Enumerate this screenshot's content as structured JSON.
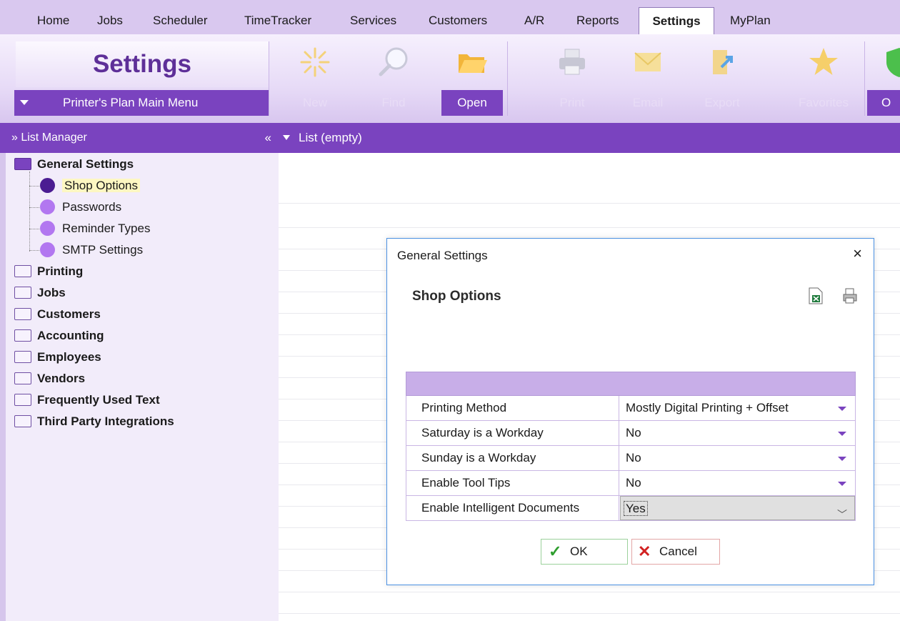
{
  "menu": {
    "tabs": [
      "Home",
      "Jobs",
      "Scheduler",
      "TimeTracker",
      "Services",
      "Customers",
      "A/R",
      "Reports",
      "Settings",
      "MyPlan"
    ],
    "active": "Settings"
  },
  "ribbon": {
    "title": "Settings",
    "main_menu": "Printer's Plan Main Menu",
    "buttons": {
      "new": "New",
      "find": "Find",
      "open": "Open",
      "print": "Print",
      "email": "Email",
      "export": "Export",
      "favorites": "Favorites",
      "ok": "O"
    }
  },
  "list_manager": {
    "title": "List Manager",
    "collapse_glyph": "«",
    "header_glyph": "»"
  },
  "list_header": {
    "title": "List (empty)"
  },
  "tree": {
    "general_settings": "General Settings",
    "children": [
      "Shop Options",
      "Passwords",
      "Reminder Types",
      "SMTP Settings"
    ],
    "folders": [
      "Printing",
      "Jobs",
      "Customers",
      "Accounting",
      "Employees",
      "Vendors",
      "Frequently Used Text",
      "Third Party Integrations"
    ]
  },
  "dialog": {
    "title": "General Settings",
    "close_glyph": "×",
    "heading": "Shop Options",
    "rows": [
      {
        "label": "Printing Method",
        "value": "Mostly Digital Printing + Offset"
      },
      {
        "label": "Saturday is a Workday",
        "value": "No"
      },
      {
        "label": "Sunday is a Workday",
        "value": "No"
      },
      {
        "label": "Enable Tool Tips",
        "value": "No"
      },
      {
        "label": "Enable Intelligent Documents",
        "value": "Yes"
      }
    ],
    "ok": "OK",
    "cancel": "Cancel",
    "chevron": "﹀"
  },
  "colors": {
    "accent": "#7a43bf",
    "menubar": "#d9c8ef",
    "panel": "#f2ecfa"
  }
}
